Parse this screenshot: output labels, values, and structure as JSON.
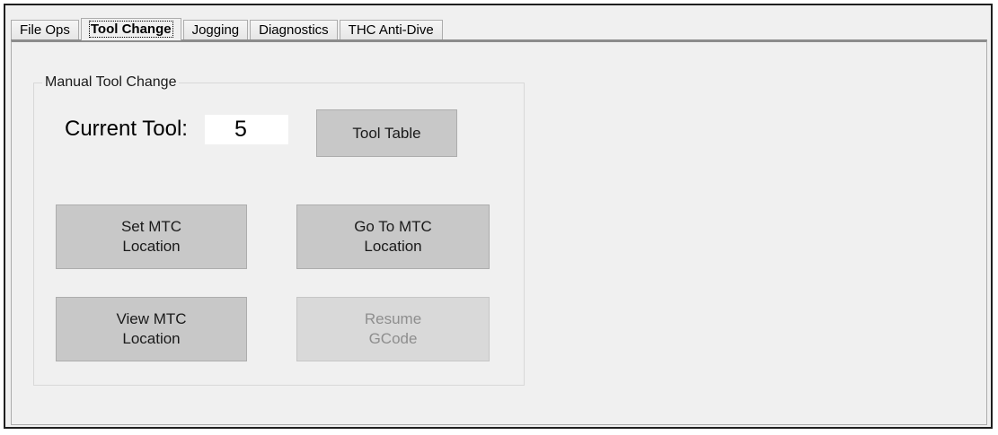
{
  "tabs": [
    {
      "label": "File Ops",
      "active": false
    },
    {
      "label": "Tool Change",
      "active": true
    },
    {
      "label": "Jogging",
      "active": false
    },
    {
      "label": "Diagnostics",
      "active": false
    },
    {
      "label": "THC Anti-Dive",
      "active": false
    }
  ],
  "manual_tool_change": {
    "title": "Manual Tool Change",
    "current_tool_label": "Current Tool:",
    "current_tool_value": "5",
    "tool_table_button": "Tool Table",
    "set_mtc_button": "Set MTC\nLocation",
    "goto_mtc_button": "Go To MTC\nLocation",
    "view_mtc_button": "View MTC\nLocation",
    "resume_gcode_button": "Resume\nGCode",
    "resume_gcode_enabled": false
  }
}
